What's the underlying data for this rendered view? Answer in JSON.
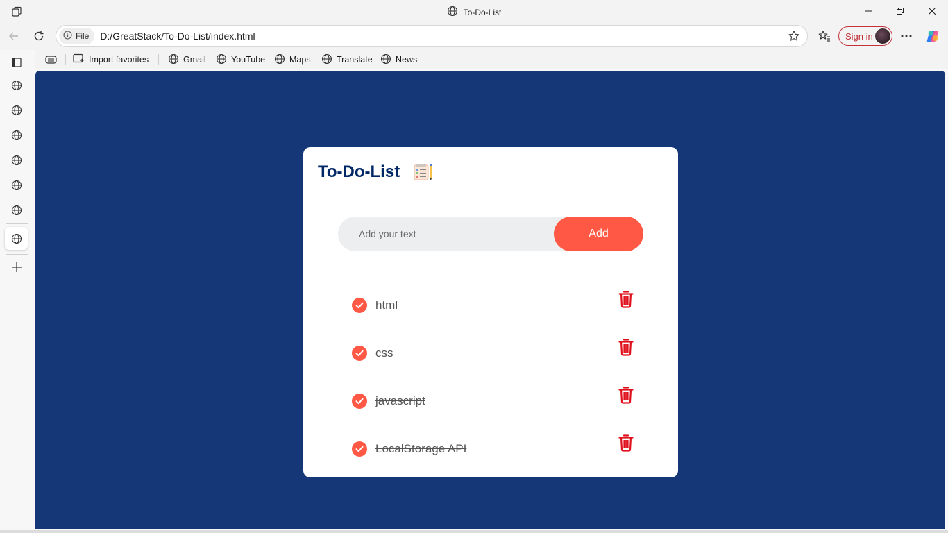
{
  "window": {
    "title": "To-Do-List"
  },
  "address": {
    "scheme_chip": "File",
    "url": "D:/GreatStack/To-Do-List/index.html"
  },
  "profile": {
    "signin_label": "Sign in"
  },
  "favorites": {
    "import_label": "Import favorites",
    "items": [
      "Gmail",
      "YouTube",
      "Maps",
      "Translate",
      "News"
    ]
  },
  "app": {
    "title": "To-Do-List",
    "input_placeholder": "Add your text",
    "add_label": "Add",
    "tasks": [
      {
        "text": "html",
        "checked": true
      },
      {
        "text": "css",
        "checked": true
      },
      {
        "text": "javascript",
        "checked": true
      },
      {
        "text": "LocalStorage API",
        "checked": true
      }
    ]
  },
  "colors": {
    "background": "#153677",
    "accent": "#ff5945",
    "title": "#002765",
    "trash": "#e0121d"
  }
}
